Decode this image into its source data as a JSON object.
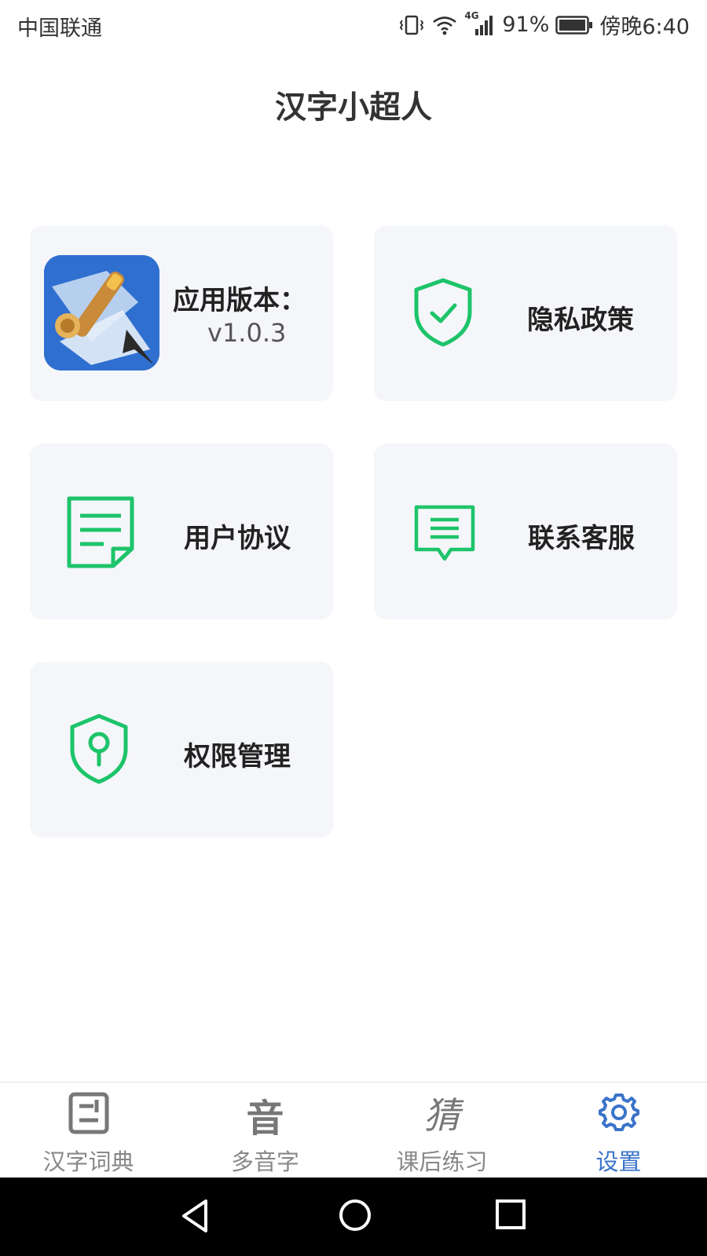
{
  "status_bar": {
    "carrier": "中国联通",
    "network": "4G",
    "battery": "91%",
    "time": "傍晚6:40"
  },
  "header": {
    "title": "汉字小超人"
  },
  "cards": {
    "version": {
      "label": "应用版本：",
      "value": "v1.0.3",
      "icon": "app-logo"
    },
    "privacy": {
      "label": "隐私政策",
      "icon": "shield-check-icon"
    },
    "agreement": {
      "label": "用户协议",
      "icon": "document-icon"
    },
    "support": {
      "label": "联系客服",
      "icon": "message-icon"
    },
    "permissions": {
      "label": "权限管理",
      "icon": "shield-key-icon"
    }
  },
  "tabbar": {
    "tabs": [
      {
        "label": "汉字词典",
        "icon": "dictionary-icon",
        "glyph": ""
      },
      {
        "label": "多音字",
        "icon": "yin-glyph-icon",
        "glyph": "音"
      },
      {
        "label": "课后练习",
        "icon": "cai-glyph-icon",
        "glyph": "猜"
      },
      {
        "label": "设置",
        "icon": "gear-icon",
        "glyph": ""
      }
    ],
    "active_index": 3
  },
  "colors": {
    "accent_green": "#1dc46a",
    "active_blue": "#3a74c9",
    "card_bg": "#f5f6fa"
  }
}
